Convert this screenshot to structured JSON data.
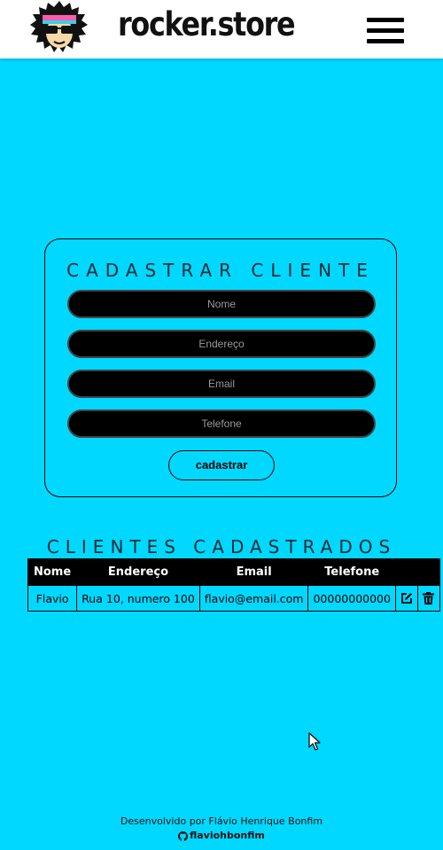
{
  "header": {
    "brand": "rocker.store",
    "logo_icon": "rocker-avatar-icon",
    "menu_icon": "hamburger-menu-icon"
  },
  "form": {
    "title": "CADASTRAR CLIENTE",
    "name_placeholder": "Nome",
    "address_placeholder": "Endereço",
    "email_placeholder": "Email",
    "phone_placeholder": "Telefone",
    "submit_label": "cadastrar"
  },
  "clients": {
    "title": "CLIENTES CADASTRADOS",
    "columns": [
      "Nome",
      "Endereço",
      "Email",
      "Telefone"
    ],
    "rows": [
      {
        "name": "Flavio",
        "address": "Rua 10, numero 100",
        "email": "flavio@email.com",
        "phone": "00000000000"
      }
    ],
    "edit_icon": "edit-icon",
    "delete_icon": "trash-icon"
  },
  "footer": {
    "credit": "Desenvolvido por Flávio Henrique Bonfim",
    "github_user": "flaviohbonfim",
    "github_icon": "github-icon"
  },
  "colors": {
    "background": "#00d8ff",
    "header": "#ffffff",
    "input_bg": "#000000",
    "table_header": "#000000"
  }
}
